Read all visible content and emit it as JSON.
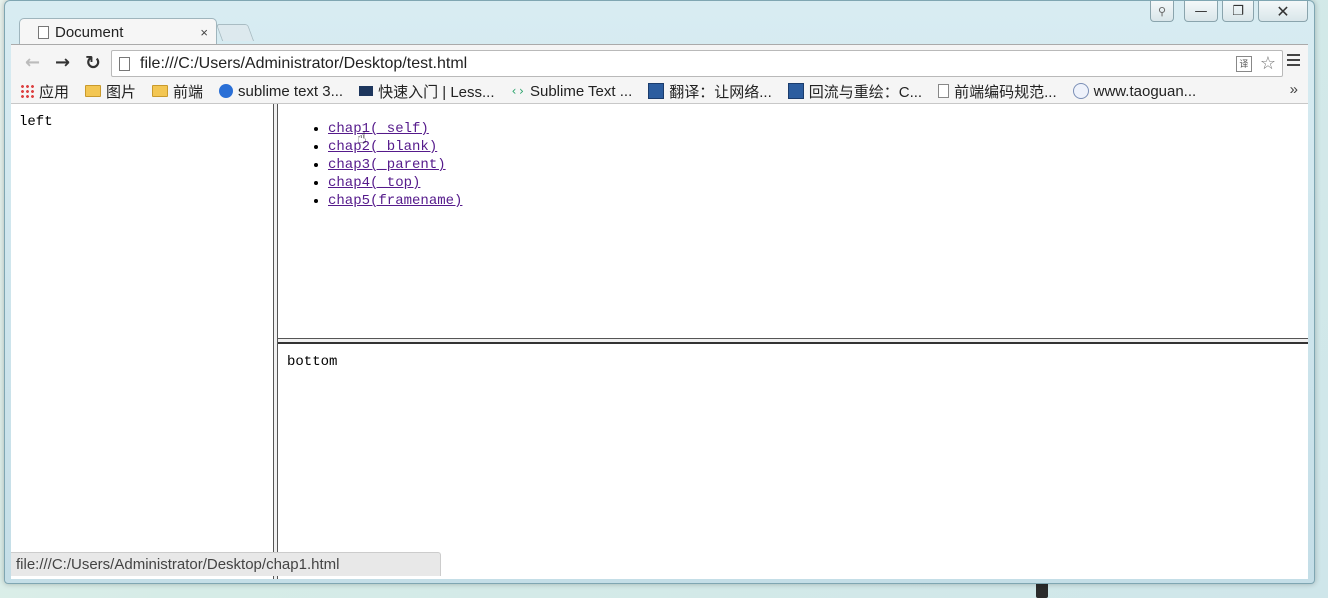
{
  "tab": {
    "title": "Document",
    "close": "×"
  },
  "window_controls": {
    "minimize": "—",
    "maximize": "❐",
    "close": "✕",
    "profile": "⚲"
  },
  "toolbar": {
    "back": "←",
    "forward": "→",
    "reload": "↻",
    "url": "file:///C:/Users/Administrator/Desktop/test.html",
    "star": "☆"
  },
  "bookmarks": {
    "items": [
      {
        "label": "应用",
        "icon": "apps-grid-icon"
      },
      {
        "label": "图片",
        "icon": "folder-icon"
      },
      {
        "label": "前端",
        "icon": "folder-icon"
      },
      {
        "label": "sublime text 3...",
        "icon": "site-icon"
      },
      {
        "label": "快速入门 | Less...",
        "icon": "less-icon"
      },
      {
        "label": "Sublime Text ...",
        "icon": "code-icon"
      },
      {
        "label": "翻译：让网络...",
        "icon": "site-icon"
      },
      {
        "label": "回流与重绘：C...",
        "icon": "site-icon"
      },
      {
        "label": "前端编码规范...",
        "icon": "page-icon"
      },
      {
        "label": "www.taoguan...",
        "icon": "globe-icon"
      }
    ],
    "more": "»"
  },
  "frames": {
    "left_text": "left",
    "links": [
      "chap1(_self)",
      "chap2(_blank)",
      "chap3(_parent)",
      "chap4(_top)",
      "chap5(framename)"
    ],
    "bottom_text": "bottom"
  },
  "status": {
    "text": "file:///C:/Users/Administrator/Desktop/chap1.html"
  },
  "colors": {
    "link_visited": "#551a8b",
    "frame_border": "#555555"
  }
}
